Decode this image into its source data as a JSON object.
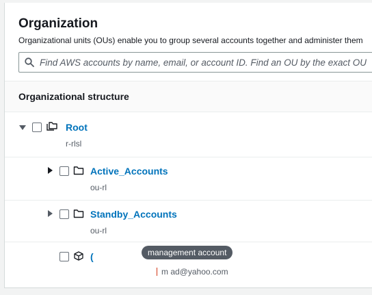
{
  "header": {
    "title": "Organization",
    "description": "Organizational units (OUs) enable you to group several accounts together and administer them"
  },
  "search": {
    "placeholder": "Find AWS accounts by name, email, or account ID. Find an OU by the exact OU"
  },
  "structure": {
    "heading": "Organizational structure",
    "root": {
      "name": "Root",
      "id": "r-rlsl"
    },
    "ous": [
      {
        "name": "Active_Accounts",
        "id": "ou-rl"
      },
      {
        "name": "Standby_Accounts",
        "id": "ou-rl"
      }
    ],
    "account": {
      "name": "(",
      "badge": "management account",
      "email": "m      ad@yahoo.com"
    }
  },
  "icons": {
    "search": "search-icon",
    "caret_expanded": "caret-down-icon",
    "caret_collapsed": "caret-right-icon",
    "root": "root-folders-icon",
    "ou": "folder-icon",
    "account": "account-cube-icon"
  },
  "colors": {
    "link": "#0073bb",
    "tooltip_bg": "#545b64",
    "caret": "#16191f"
  }
}
